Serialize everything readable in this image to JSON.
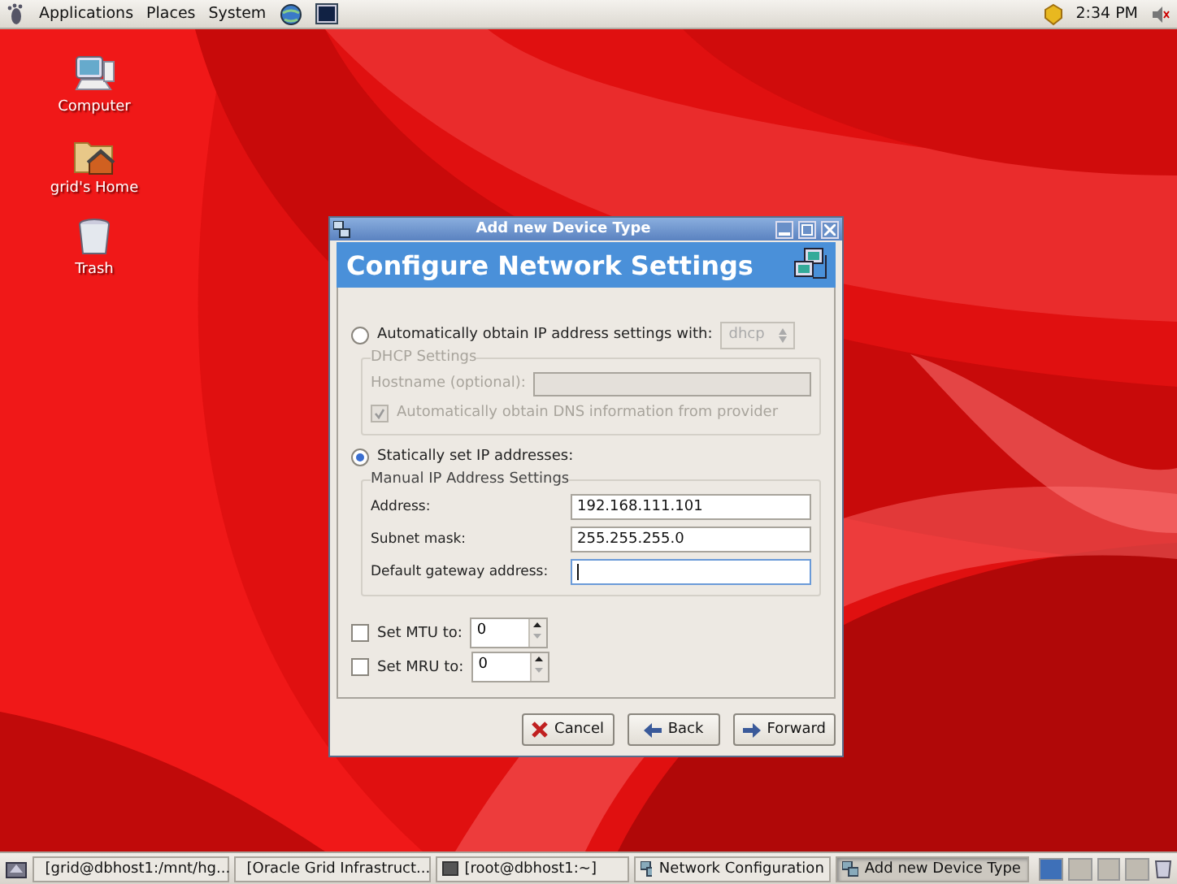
{
  "top_panel": {
    "menus": [
      "Applications",
      "Places",
      "System"
    ],
    "clock": "2:34 PM"
  },
  "desktop_icons": [
    {
      "label": "Computer",
      "kind": "computer"
    },
    {
      "label": "grid's Home",
      "kind": "home"
    },
    {
      "label": "Trash",
      "kind": "trash"
    }
  ],
  "dialog": {
    "title": "Add new Device Type",
    "heading": "Configure Network Settings",
    "modes": [
      {
        "label": "Automatically obtain IP address settings with:",
        "selected": false
      },
      {
        "label": "Statically set IP addresses:",
        "selected": true
      }
    ],
    "dhcp": {
      "protocol": "dhcp",
      "group": "DHCP Settings",
      "hostname_label": "Hostname (optional):",
      "dns_label": "Automatically obtain DNS information from provider",
      "dns_checked": true,
      "disabled": true
    },
    "manual": {
      "group": "Manual IP Address Settings",
      "fields": [
        {
          "label": "Address:",
          "value": "192.168.111.101",
          "focused": false
        },
        {
          "label": "Subnet mask:",
          "value": "255.255.255.0",
          "focused": false
        },
        {
          "label": "Default gateway address:",
          "focused": true
        }
      ]
    },
    "units": [
      {
        "label": "Set MTU to:",
        "value": "0",
        "checked": false
      },
      {
        "label": "Set MRU to:",
        "value": "0",
        "checked": false
      }
    ],
    "buttons": [
      {
        "label": "Cancel",
        "kind": "cancel"
      },
      {
        "label": "Back",
        "kind": "back"
      },
      {
        "label": "Forward",
        "kind": "forward"
      }
    ]
  },
  "taskbar": {
    "tasks": [
      {
        "label": "[grid@dbhost1:/mnt/hg...",
        "kind": "terminal",
        "selected": false
      },
      {
        "label": "[Oracle Grid Infrastruct...",
        "kind": "window",
        "selected": false
      },
      {
        "label": "[root@dbhost1:~]",
        "kind": "terminal",
        "selected": false
      },
      {
        "label": "Network Configuration",
        "kind": "network",
        "selected": false
      },
      {
        "label": "Add new Device Type",
        "kind": "network",
        "selected": true
      }
    ],
    "workspaces": [
      {
        "selected": true
      },
      {
        "selected": false
      },
      {
        "selected": false
      },
      {
        "selected": false
      }
    ]
  }
}
